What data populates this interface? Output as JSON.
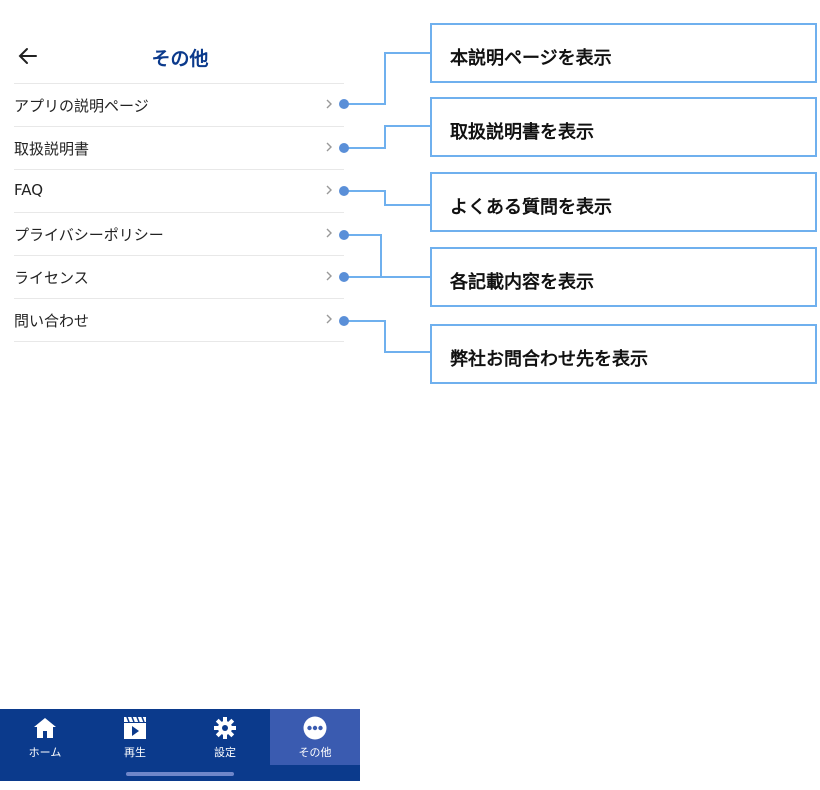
{
  "header": {
    "title": "その他",
    "back_icon": "arrow-left-icon"
  },
  "menu": {
    "items": [
      {
        "label": "アプリの説明ページ"
      },
      {
        "label": "取扱説明書"
      },
      {
        "label": "FAQ"
      },
      {
        "label": "プライバシーポリシー"
      },
      {
        "label": "ライセンス"
      },
      {
        "label": "問い合わせ"
      }
    ]
  },
  "bottom_nav": {
    "items": [
      {
        "label": "ホーム",
        "icon": "home-icon"
      },
      {
        "label": "再生",
        "icon": "play-icon"
      },
      {
        "label": "設定",
        "icon": "gear-icon"
      },
      {
        "label": "その他",
        "icon": "more-icon",
        "active": true
      }
    ]
  },
  "callouts": [
    {
      "text": "本説明ページを表示"
    },
    {
      "text": "取扱説明書を表示"
    },
    {
      "text": "よくある質問を表示"
    },
    {
      "text": "各記載内容を表示"
    },
    {
      "text": "弊社お問合わせ先を表示"
    }
  ],
  "colors": {
    "brand": "#0b3a8c",
    "active_tab": "#3a5bb0",
    "annotation": "#6fb0ee"
  }
}
